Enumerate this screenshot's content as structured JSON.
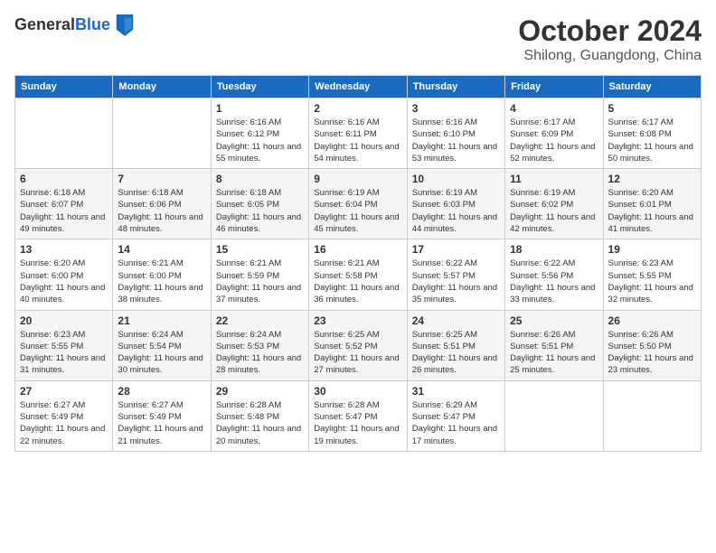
{
  "logo": {
    "general": "General",
    "blue": "Blue"
  },
  "header": {
    "month": "October 2024",
    "location": "Shilong, Guangdong, China"
  },
  "columns": [
    "Sunday",
    "Monday",
    "Tuesday",
    "Wednesday",
    "Thursday",
    "Friday",
    "Saturday"
  ],
  "weeks": [
    [
      {
        "day": "",
        "sunrise": "",
        "sunset": "",
        "daylight": ""
      },
      {
        "day": "",
        "sunrise": "",
        "sunset": "",
        "daylight": ""
      },
      {
        "day": "1",
        "sunrise": "Sunrise: 6:16 AM",
        "sunset": "Sunset: 6:12 PM",
        "daylight": "Daylight: 11 hours and 55 minutes."
      },
      {
        "day": "2",
        "sunrise": "Sunrise: 6:16 AM",
        "sunset": "Sunset: 6:11 PM",
        "daylight": "Daylight: 11 hours and 54 minutes."
      },
      {
        "day": "3",
        "sunrise": "Sunrise: 6:16 AM",
        "sunset": "Sunset: 6:10 PM",
        "daylight": "Daylight: 11 hours and 53 minutes."
      },
      {
        "day": "4",
        "sunrise": "Sunrise: 6:17 AM",
        "sunset": "Sunset: 6:09 PM",
        "daylight": "Daylight: 11 hours and 52 minutes."
      },
      {
        "day": "5",
        "sunrise": "Sunrise: 6:17 AM",
        "sunset": "Sunset: 6:08 PM",
        "daylight": "Daylight: 11 hours and 50 minutes."
      }
    ],
    [
      {
        "day": "6",
        "sunrise": "Sunrise: 6:18 AM",
        "sunset": "Sunset: 6:07 PM",
        "daylight": "Daylight: 11 hours and 49 minutes."
      },
      {
        "day": "7",
        "sunrise": "Sunrise: 6:18 AM",
        "sunset": "Sunset: 6:06 PM",
        "daylight": "Daylight: 11 hours and 48 minutes."
      },
      {
        "day": "8",
        "sunrise": "Sunrise: 6:18 AM",
        "sunset": "Sunset: 6:05 PM",
        "daylight": "Daylight: 11 hours and 46 minutes."
      },
      {
        "day": "9",
        "sunrise": "Sunrise: 6:19 AM",
        "sunset": "Sunset: 6:04 PM",
        "daylight": "Daylight: 11 hours and 45 minutes."
      },
      {
        "day": "10",
        "sunrise": "Sunrise: 6:19 AM",
        "sunset": "Sunset: 6:03 PM",
        "daylight": "Daylight: 11 hours and 44 minutes."
      },
      {
        "day": "11",
        "sunrise": "Sunrise: 6:19 AM",
        "sunset": "Sunset: 6:02 PM",
        "daylight": "Daylight: 11 hours and 42 minutes."
      },
      {
        "day": "12",
        "sunrise": "Sunrise: 6:20 AM",
        "sunset": "Sunset: 6:01 PM",
        "daylight": "Daylight: 11 hours and 41 minutes."
      }
    ],
    [
      {
        "day": "13",
        "sunrise": "Sunrise: 6:20 AM",
        "sunset": "Sunset: 6:00 PM",
        "daylight": "Daylight: 11 hours and 40 minutes."
      },
      {
        "day": "14",
        "sunrise": "Sunrise: 6:21 AM",
        "sunset": "Sunset: 6:00 PM",
        "daylight": "Daylight: 11 hours and 38 minutes."
      },
      {
        "day": "15",
        "sunrise": "Sunrise: 6:21 AM",
        "sunset": "Sunset: 5:59 PM",
        "daylight": "Daylight: 11 hours and 37 minutes."
      },
      {
        "day": "16",
        "sunrise": "Sunrise: 6:21 AM",
        "sunset": "Sunset: 5:58 PM",
        "daylight": "Daylight: 11 hours and 36 minutes."
      },
      {
        "day": "17",
        "sunrise": "Sunrise: 6:22 AM",
        "sunset": "Sunset: 5:57 PM",
        "daylight": "Daylight: 11 hours and 35 minutes."
      },
      {
        "day": "18",
        "sunrise": "Sunrise: 6:22 AM",
        "sunset": "Sunset: 5:56 PM",
        "daylight": "Daylight: 11 hours and 33 minutes."
      },
      {
        "day": "19",
        "sunrise": "Sunrise: 6:23 AM",
        "sunset": "Sunset: 5:55 PM",
        "daylight": "Daylight: 11 hours and 32 minutes."
      }
    ],
    [
      {
        "day": "20",
        "sunrise": "Sunrise: 6:23 AM",
        "sunset": "Sunset: 5:55 PM",
        "daylight": "Daylight: 11 hours and 31 minutes."
      },
      {
        "day": "21",
        "sunrise": "Sunrise: 6:24 AM",
        "sunset": "Sunset: 5:54 PM",
        "daylight": "Daylight: 11 hours and 30 minutes."
      },
      {
        "day": "22",
        "sunrise": "Sunrise: 6:24 AM",
        "sunset": "Sunset: 5:53 PM",
        "daylight": "Daylight: 11 hours and 28 minutes."
      },
      {
        "day": "23",
        "sunrise": "Sunrise: 6:25 AM",
        "sunset": "Sunset: 5:52 PM",
        "daylight": "Daylight: 11 hours and 27 minutes."
      },
      {
        "day": "24",
        "sunrise": "Sunrise: 6:25 AM",
        "sunset": "Sunset: 5:51 PM",
        "daylight": "Daylight: 11 hours and 26 minutes."
      },
      {
        "day": "25",
        "sunrise": "Sunrise: 6:26 AM",
        "sunset": "Sunset: 5:51 PM",
        "daylight": "Daylight: 11 hours and 25 minutes."
      },
      {
        "day": "26",
        "sunrise": "Sunrise: 6:26 AM",
        "sunset": "Sunset: 5:50 PM",
        "daylight": "Daylight: 11 hours and 23 minutes."
      }
    ],
    [
      {
        "day": "27",
        "sunrise": "Sunrise: 6:27 AM",
        "sunset": "Sunset: 5:49 PM",
        "daylight": "Daylight: 11 hours and 22 minutes."
      },
      {
        "day": "28",
        "sunrise": "Sunrise: 6:27 AM",
        "sunset": "Sunset: 5:49 PM",
        "daylight": "Daylight: 11 hours and 21 minutes."
      },
      {
        "day": "29",
        "sunrise": "Sunrise: 6:28 AM",
        "sunset": "Sunset: 5:48 PM",
        "daylight": "Daylight: 11 hours and 20 minutes."
      },
      {
        "day": "30",
        "sunrise": "Sunrise: 6:28 AM",
        "sunset": "Sunset: 5:47 PM",
        "daylight": "Daylight: 11 hours and 19 minutes."
      },
      {
        "day": "31",
        "sunrise": "Sunrise: 6:29 AM",
        "sunset": "Sunset: 5:47 PM",
        "daylight": "Daylight: 11 hours and 17 minutes."
      },
      {
        "day": "",
        "sunrise": "",
        "sunset": "",
        "daylight": ""
      },
      {
        "day": "",
        "sunrise": "",
        "sunset": "",
        "daylight": ""
      }
    ]
  ]
}
